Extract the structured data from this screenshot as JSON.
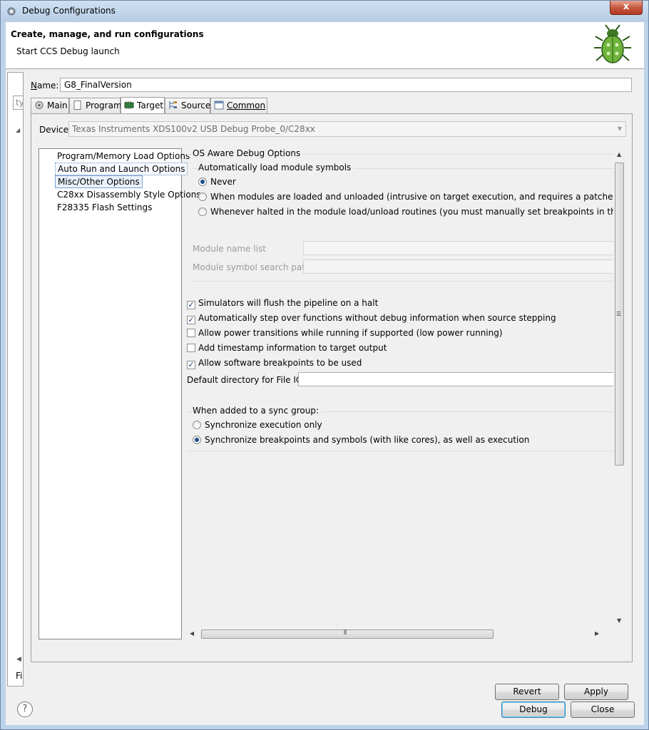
{
  "window": {
    "title": "Debug Configurations",
    "close_symbol": "x"
  },
  "header": {
    "title": "Create, manage, and run configurations",
    "subtitle": "Start CCS Debug launch"
  },
  "left_pane": {
    "filter_placeholder": "ty",
    "filter_label": "Fil"
  },
  "name": {
    "label_underlined": "N",
    "label_rest": "ame:",
    "value": "G8_FinalVersion"
  },
  "tabs": [
    {
      "label": "Main",
      "icon": "main-icon"
    },
    {
      "label": "Program",
      "icon": "document-icon"
    },
    {
      "label": "Target",
      "icon": "chip-icon",
      "active": true
    },
    {
      "label": "Source",
      "icon": "source-icon"
    },
    {
      "label": "Common",
      "icon": "common-icon"
    }
  ],
  "device": {
    "label": "Device",
    "value": "Texas Instruments XDS100v2 USB Debug Probe_0/C28xx"
  },
  "categories": [
    "Program/Memory Load Options",
    "Auto Run and Launch Options",
    "Misc/Other Options",
    "C28xx Disassembly Style Options",
    "F28335 Flash Settings"
  ],
  "os_aware": {
    "title": "OS Aware Debug Options",
    "sub_title": "Automatically load module symbols",
    "radios": [
      {
        "label": "Never",
        "checked": true
      },
      {
        "label": "When modules are loaded and unloaded (intrusive on target execution, and requires a patched kernel)",
        "checked": false
      },
      {
        "label": "Whenever halted in the module load/unload routines (you must manually set breakpoints in the appropr",
        "checked": false
      }
    ],
    "module_name_list_label": "Module name list",
    "module_symbol_path_label": "Module symbol search path"
  },
  "checks": [
    {
      "label": "Simulators will flush the pipeline on a halt",
      "checked": true
    },
    {
      "label": "Automatically step over functions without debug information when source stepping",
      "checked": true
    },
    {
      "label": "Allow power transitions while running if supported (low power running)",
      "checked": false
    },
    {
      "label": "Add timestamp information to target output",
      "checked": false
    },
    {
      "label": "Allow software breakpoints to be used",
      "checked": true
    }
  ],
  "file_io": {
    "label": "Default directory for File IO:",
    "value": ""
  },
  "sync": {
    "title": "When added to a sync group:",
    "radios": [
      {
        "label": "Synchronize execution only",
        "checked": false
      },
      {
        "label": "Synchronize breakpoints and symbols (with like cores), as well as execution",
        "checked": true
      }
    ]
  },
  "buttons": {
    "revert": "Revert",
    "apply": "Apply",
    "debug": "Debug",
    "close": "Close"
  }
}
